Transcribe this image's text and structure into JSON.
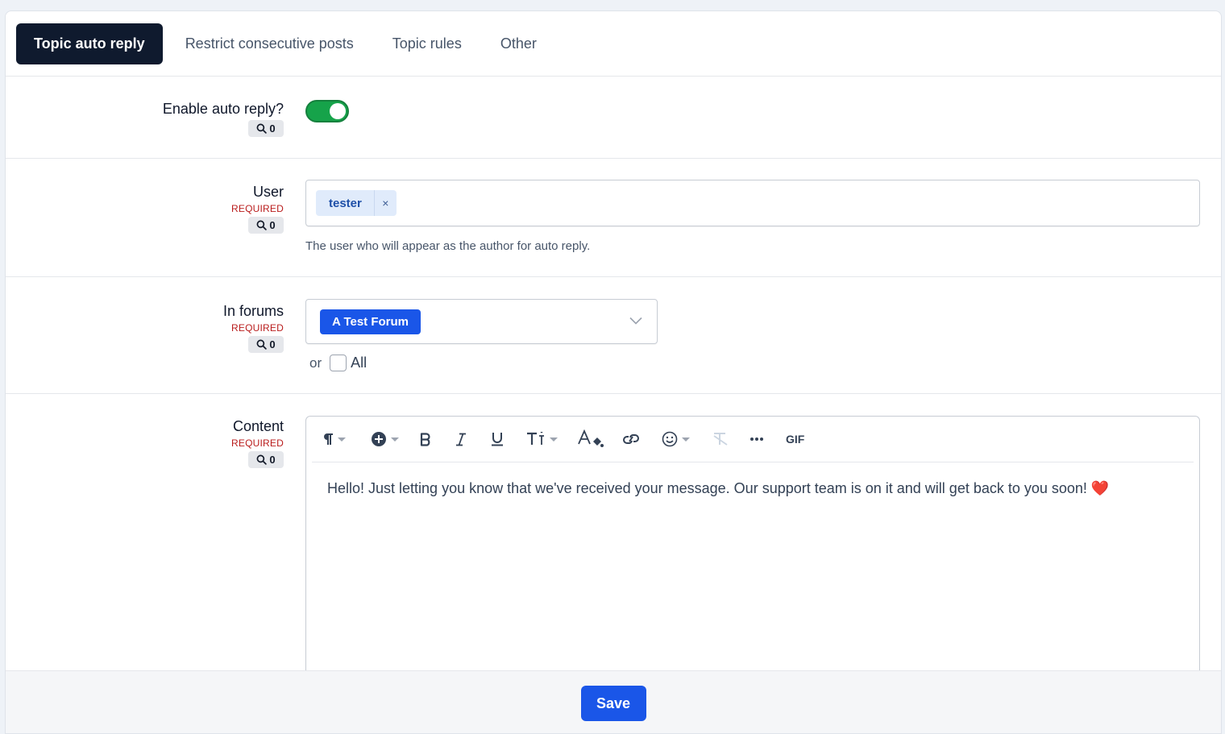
{
  "tabs": [
    {
      "label": "Topic auto reply",
      "active": true
    },
    {
      "label": "Restrict consecutive posts"
    },
    {
      "label": "Topic rules"
    },
    {
      "label": "Other"
    }
  ],
  "enable_row": {
    "label": "Enable auto reply?",
    "search_count": "0",
    "toggle_on": true
  },
  "user_row": {
    "label": "User",
    "required": "REQUIRED",
    "search_count": "0",
    "selected_user": "tester",
    "remove_glyph": "×",
    "help": "The user who will appear as the author for auto reply."
  },
  "forums_row": {
    "label": "In forums",
    "required": "REQUIRED",
    "search_count": "0",
    "selected_forum": "A Test Forum",
    "or_text": "or",
    "all_label": "All"
  },
  "content_row": {
    "label": "Content",
    "required": "REQUIRED",
    "search_count": "0",
    "toolbar_gif": "GIF",
    "text": "Hello! Just letting you know that we've received your message. Our support team is on it and will get back to you soon! ❤️"
  },
  "footer": {
    "save_label": "Save"
  },
  "colors": {
    "accent": "#1a56e8",
    "toggle_on": "#16a34a",
    "required": "#b91c1c",
    "active_tab": "#0f1a2e"
  },
  "icons": {
    "search": "search-icon",
    "paragraph": "paragraph-icon",
    "insert": "plus-circle-icon",
    "bold": "bold-icon",
    "italic": "italic-icon",
    "underline": "underline-icon",
    "font_size": "font-size-icon",
    "text_color": "text-color-icon",
    "link": "link-icon",
    "emoji": "emoji-icon",
    "clear_format": "clear-format-icon",
    "more": "more-icon",
    "chevron": "chevron-down-icon"
  }
}
